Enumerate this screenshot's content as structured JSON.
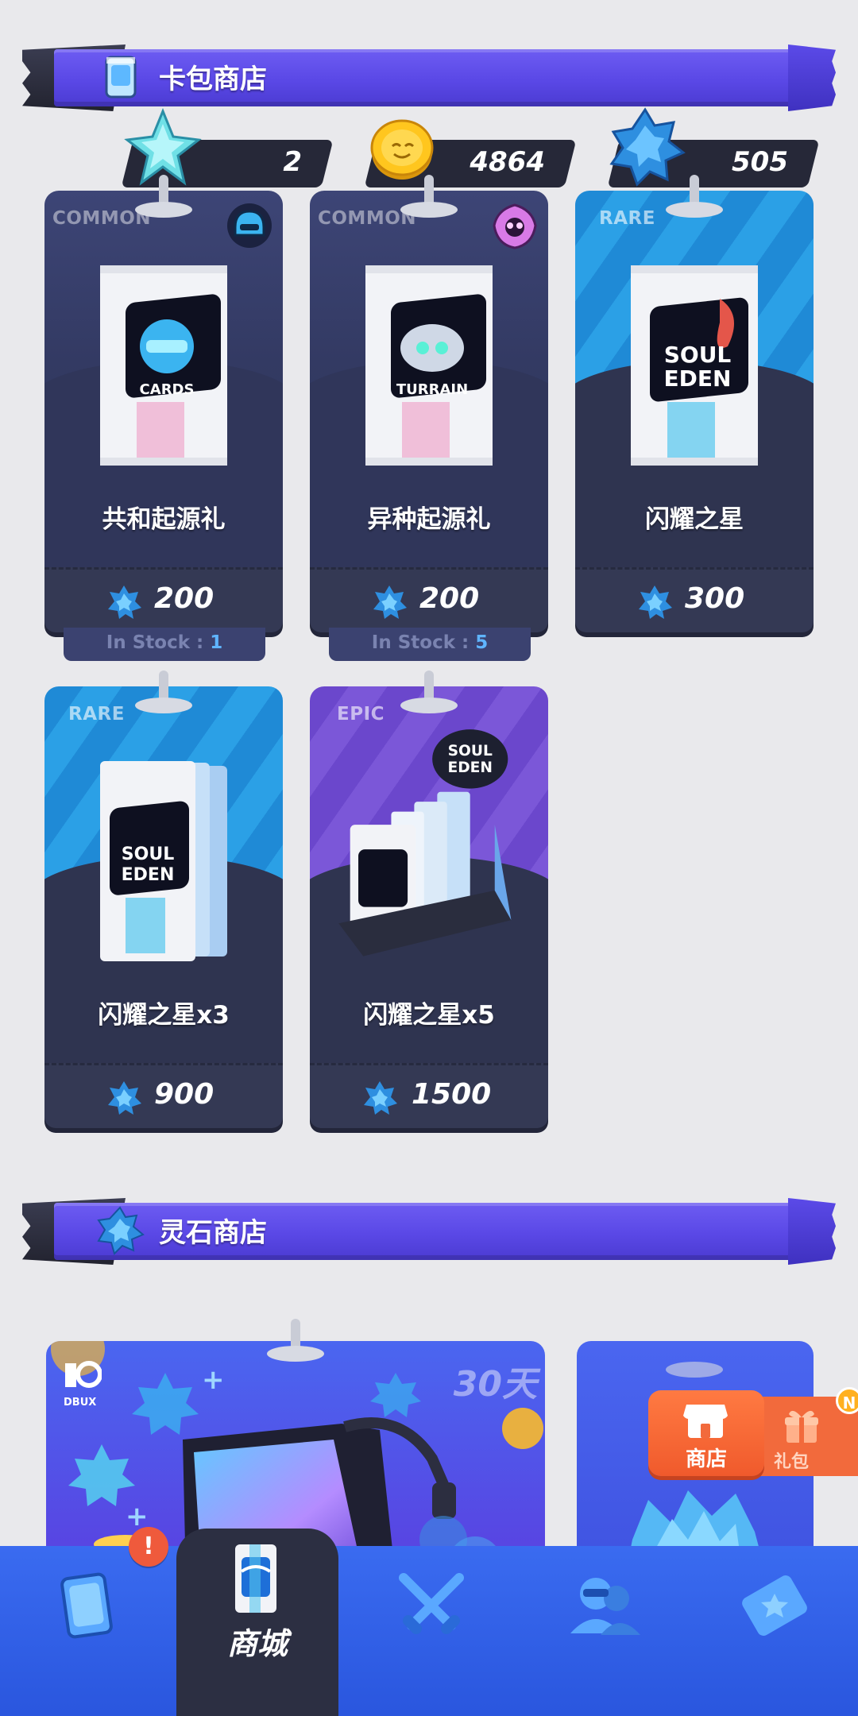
{
  "sections": {
    "card_shop_title": "卡包商店",
    "crystal_shop_title": "灵石商店"
  },
  "currencies": [
    {
      "name": "star-shard",
      "value": "2"
    },
    {
      "name": "coin",
      "value": "4864"
    },
    {
      "name": "crystal",
      "value": "505"
    }
  ],
  "cards": [
    {
      "rarity": "COMMON",
      "name": "共和起源礼",
      "price": "200",
      "stock_label": "In Stock : ",
      "stock": "1"
    },
    {
      "rarity": "COMMON",
      "name": "异种起源礼",
      "price": "200",
      "stock_label": "In Stock : ",
      "stock": "5"
    },
    {
      "rarity": "RARE",
      "name": "闪耀之星",
      "price": "300"
    },
    {
      "rarity": "RARE",
      "name": "闪耀之星x3",
      "price": "900"
    },
    {
      "rarity": "EPIC",
      "name": "闪耀之星x5",
      "price": "1500"
    }
  ],
  "crystal_shop": {
    "days_label": "30天",
    "brand": "DBUX"
  },
  "floating": {
    "store_label": "商店",
    "gift_label": "礼包",
    "new_badge": "N"
  },
  "nav": {
    "active_label": "商城",
    "badge": "!"
  },
  "colors": {
    "banner": "#5a48e6",
    "nav": "#2a56de",
    "rare": "#1f8ad6",
    "epic": "#6b47cc",
    "common": "#333a63",
    "price_bar": "#343954",
    "store_button": "#f26a3c"
  }
}
